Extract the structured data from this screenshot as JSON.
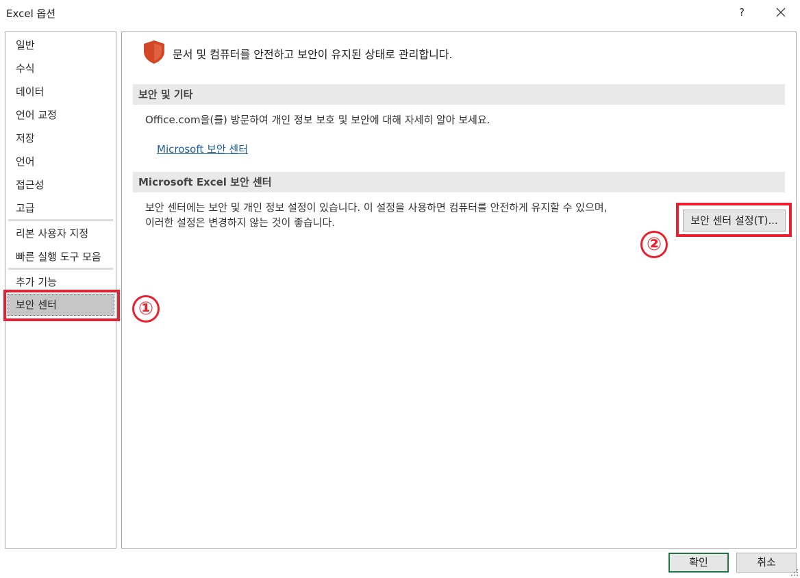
{
  "window": {
    "title": "Excel 옵션",
    "help_label": "?",
    "close_icon": "close-icon"
  },
  "sidebar": {
    "items": [
      {
        "label": "일반"
      },
      {
        "label": "수식"
      },
      {
        "label": "데이터"
      },
      {
        "label": "언어 교정"
      },
      {
        "label": "저장"
      },
      {
        "label": "언어"
      },
      {
        "label": "접근성"
      },
      {
        "label": "고급"
      },
      {
        "label": "리본 사용자 지정"
      },
      {
        "label": "빠른 실행 도구 모음"
      },
      {
        "label": "추가 기능"
      },
      {
        "label": "보안 센터"
      }
    ],
    "selected": "보안 센터"
  },
  "main": {
    "header_icon": "shield-icon",
    "header_text": "문서 및 컴퓨터를 안전하고 보안이 유지된 상태로 관리합니다.",
    "section1": {
      "title": "보안 및 기타",
      "text": "Office.com을(를) 방문하여 개인 정보 보호 및 보안에 대해 자세히 알아 보세요.",
      "link": "Microsoft 보안 센터"
    },
    "section2": {
      "title": "Microsoft Excel 보안 센터",
      "text_line1": "보안 센터에는 보안 및 개인 정보 설정이 있습니다. 이 설정을 사용하면 컴퓨터를 안전하게 유지할 수 있으며,",
      "text_line2": "이러한 설정은 변경하지 않는 것이 좋습니다.",
      "button": "보안 센터 설정(T)..."
    }
  },
  "annotations": {
    "marker1": "①",
    "marker2": "②",
    "color": "#e8202f"
  },
  "footer": {
    "ok": "확인",
    "cancel": "취소"
  },
  "colors": {
    "accent_green": "#217346",
    "link_blue": "#1a5f9e",
    "shield": "#d24726"
  }
}
